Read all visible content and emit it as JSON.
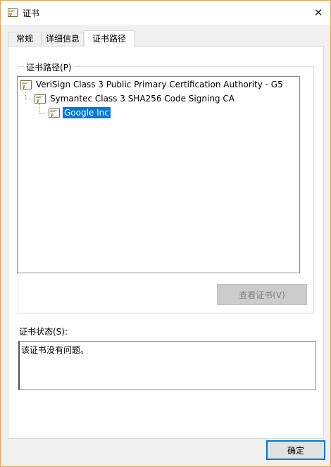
{
  "window": {
    "title": "证书",
    "close_glyph": "✕"
  },
  "tabs": [
    {
      "label": "常规"
    },
    {
      "label": "详细信息"
    },
    {
      "label": "证书路径"
    }
  ],
  "active_tab": "证书路径",
  "cert_path": {
    "group_label": "证书路径(P)",
    "tree": [
      {
        "label": "VeriSign Class 3 Public Primary Certification Authority - G5",
        "level": 0,
        "selected": false
      },
      {
        "label": "Symantec Class 3 SHA256 Code Signing CA",
        "level": 1,
        "selected": false
      },
      {
        "label": "Google Inc",
        "level": 2,
        "selected": true
      }
    ],
    "view_cert_button": "查看证书(V)"
  },
  "status": {
    "label": "证书状态(S):",
    "text": "该证书没有问题。"
  },
  "buttons": {
    "ok": "确定"
  },
  "colors": {
    "window_border": "#e8a35a",
    "selection": "#0078d7",
    "icon_gold": "#e0a62a",
    "icon_red": "#c0392b"
  }
}
